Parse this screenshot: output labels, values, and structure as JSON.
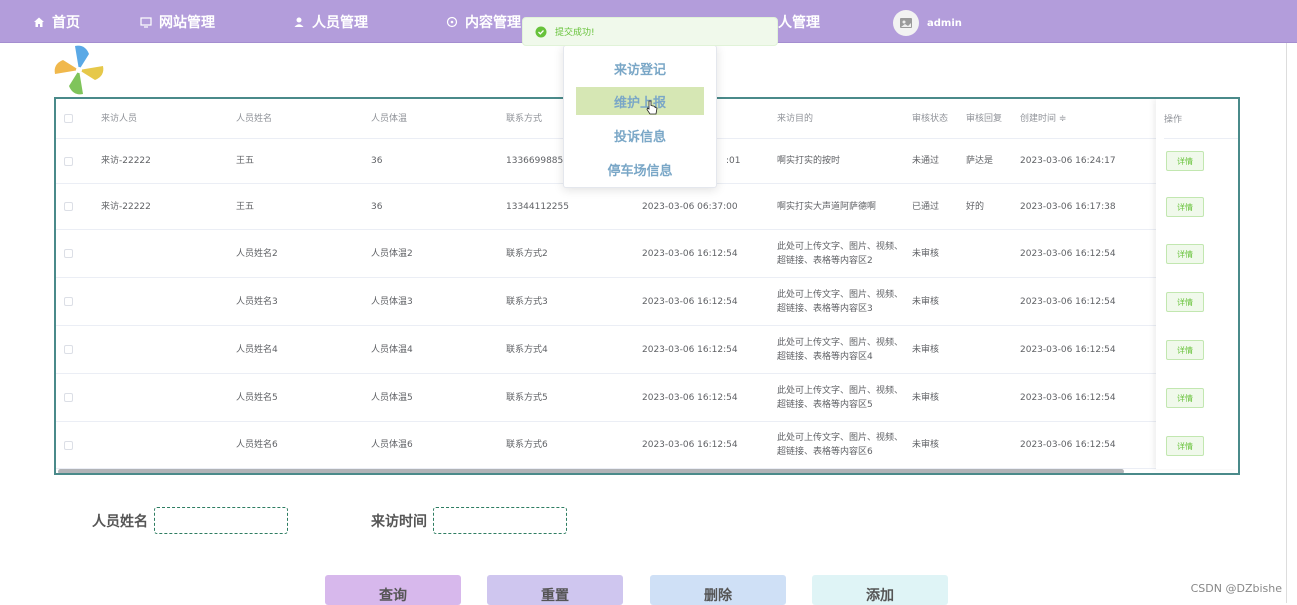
{
  "nav": {
    "items": [
      {
        "label": "首页",
        "icon": "home-icon"
      },
      {
        "label": "网站管理",
        "icon": "monitor-icon"
      },
      {
        "label": "人员管理",
        "icon": "user-icon"
      },
      {
        "label": "内容管理",
        "icon": "circle-icon"
      },
      {
        "label": "人管理",
        "icon": ""
      }
    ],
    "user": "admin"
  },
  "toast": {
    "message": "提交成功!",
    "color": "#67c23a"
  },
  "dropdown": {
    "items": [
      "来访登记",
      "维护上报",
      "投诉信息",
      "停车场信息"
    ],
    "active_index": 1
  },
  "table": {
    "headers": [
      "来访人员",
      "人员姓名",
      "人员体温",
      "联系方式",
      "",
      "来访目的",
      "审核状态",
      "审核回复",
      "创建时间 ≑",
      "操作"
    ],
    "rows": [
      {
        "visitor": "来访-22222",
        "name": "王五",
        "temp": "36",
        "phone": "13366998855",
        "time": ":01",
        "purpose": "啊实打实的按时",
        "status": "未通过",
        "reply": "萨达是",
        "created": "2023-03-06 16:24:17"
      },
      {
        "visitor": "来访-22222",
        "name": "王五",
        "temp": "36",
        "phone": "13344112255",
        "time": "2023-03-06 06:37:00",
        "purpose": "啊实打实大声道阿萨德啊",
        "status": "已通过",
        "reply": "好的",
        "created": "2023-03-06 16:17:38"
      },
      {
        "visitor": "",
        "name": "人员姓名2",
        "temp": "人员体温2",
        "phone": "联系方式2",
        "time": "2023-03-06 16:12:54",
        "purpose": "此处可上传文字、图片、视频、超链接、表格等内容区2",
        "status": "未审核",
        "reply": "",
        "created": "2023-03-06 16:12:54"
      },
      {
        "visitor": "",
        "name": "人员姓名3",
        "temp": "人员体温3",
        "phone": "联系方式3",
        "time": "2023-03-06 16:12:54",
        "purpose": "此处可上传文字、图片、视频、超链接、表格等内容区3",
        "status": "未审核",
        "reply": "",
        "created": "2023-03-06 16:12:54"
      },
      {
        "visitor": "",
        "name": "人员姓名4",
        "temp": "人员体温4",
        "phone": "联系方式4",
        "time": "2023-03-06 16:12:54",
        "purpose": "此处可上传文字、图片、视频、超链接、表格等内容区4",
        "status": "未审核",
        "reply": "",
        "created": "2023-03-06 16:12:54"
      },
      {
        "visitor": "",
        "name": "人员姓名5",
        "temp": "人员体温5",
        "phone": "联系方式5",
        "time": "2023-03-06 16:12:54",
        "purpose": "此处可上传文字、图片、视频、超链接、表格等内容区5",
        "status": "未审核",
        "reply": "",
        "created": "2023-03-06 16:12:54"
      },
      {
        "visitor": "",
        "name": "人员姓名6",
        "temp": "人员体温6",
        "phone": "联系方式6",
        "time": "2023-03-06 16:12:54",
        "purpose": "此处可上传文字、图片、视频、超链接、表格等内容区6",
        "status": "未审核",
        "reply": "",
        "created": "2023-03-06 16:12:54"
      }
    ],
    "detail_label": "详情"
  },
  "search": {
    "name_label": "人员姓名",
    "time_label": "来访时间",
    "name_value": "",
    "time_value": ""
  },
  "actions": [
    {
      "label": "查询",
      "color": "#d7b8ec"
    },
    {
      "label": "重置",
      "color": "#cfc6ef"
    },
    {
      "label": "删除",
      "color": "#cfe0f6"
    },
    {
      "label": "添加",
      "color": "#dff4f6"
    }
  ],
  "watermark": "CSDN @DZbishe"
}
